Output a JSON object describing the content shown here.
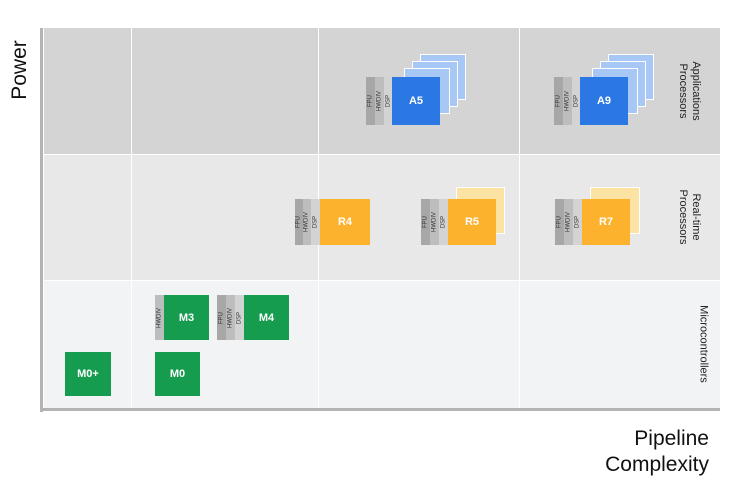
{
  "axes": {
    "y_label": "Power",
    "x_label_line1": "Pipeline",
    "x_label_line2": "Complexity"
  },
  "bands": {
    "applications": {
      "line1": "Applications",
      "line2": "Processors"
    },
    "realtime": {
      "line1": "Real-time",
      "line2": "Processors"
    },
    "microcontrollers": {
      "line1": "Microcontrollers"
    }
  },
  "features": {
    "fpu": "FPU",
    "hwdiv": "HWDIV",
    "dsp": "DSP"
  },
  "processors": {
    "a5": "A5",
    "a9": "A9",
    "r4": "R4",
    "r5": "R5",
    "r7": "R7",
    "m3": "M3",
    "m4": "M4",
    "m0plus": "M0+",
    "m0": "M0"
  },
  "colors": {
    "applications": "#2b78e4",
    "realtime": "#fdb22e",
    "microcontrollers": "#169c4f"
  }
}
